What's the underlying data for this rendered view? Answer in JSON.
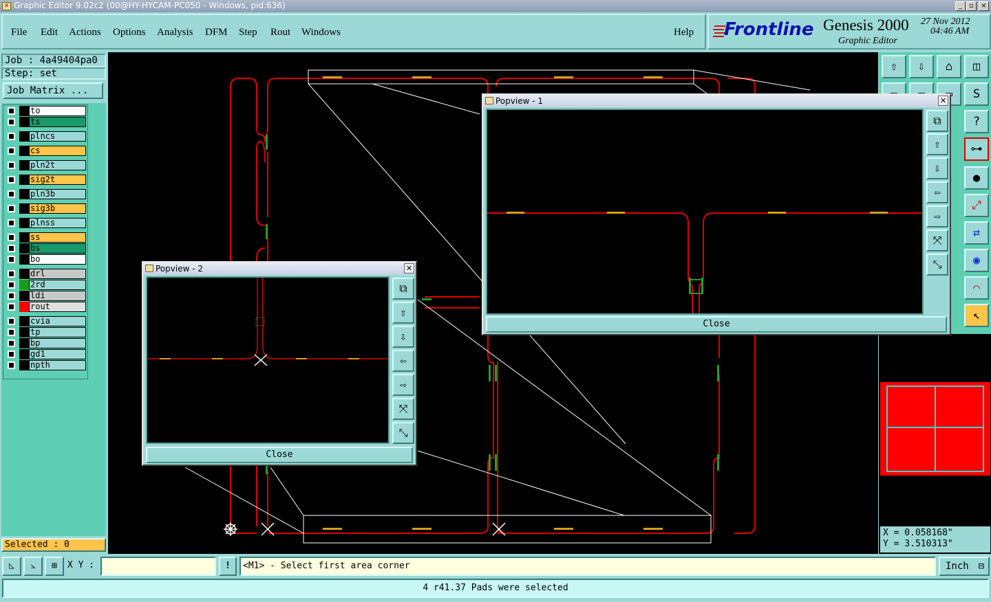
{
  "window": {
    "title": "Graphic Editor 9.02c2 (00@HY-HYCAM-PC050 - Windows, pid:636)",
    "minimize": "_",
    "maximize": "▫",
    "close": "×"
  },
  "menu": [
    "File",
    "Edit",
    "Actions",
    "Options",
    "Analysis",
    "DFM",
    "Step",
    "Rout",
    "Windows"
  ],
  "help": "Help",
  "brand": {
    "logo": "Frontline",
    "product": "Genesis 2000",
    "subtitle": "Graphic Editor",
    "date": "27 Nov 2012",
    "time": "04:46 AM"
  },
  "job": {
    "label": "Job : 4a49404pa0",
    "step": "Step: set",
    "matrix_button": "Job Matrix ..."
  },
  "layers": [
    {
      "name": "to",
      "bg": "#ffffff",
      "sw": "#000000"
    },
    {
      "name": "ts",
      "bg": "#1a9a6a",
      "sw": "#000000"
    },
    {
      "name": "plncs",
      "bg": "#9cd9d6",
      "sw": "#000000"
    },
    {
      "name": "cs",
      "bg": "#ffc44a",
      "sw": "#000000"
    },
    {
      "name": "pln2t",
      "bg": "#9cd9d6",
      "sw": "#000000"
    },
    {
      "name": "sig2t",
      "bg": "#ffc44a",
      "sw": "#000000"
    },
    {
      "name": "pln3b",
      "bg": "#9cd9d6",
      "sw": "#000000"
    },
    {
      "name": "sig3b",
      "bg": "#ffc44a",
      "sw": "#000000"
    },
    {
      "name": "plnss",
      "bg": "#9cd9d6",
      "sw": "#000000"
    },
    {
      "name": "ss",
      "bg": "#ffc44a",
      "sw": "#000000"
    },
    {
      "name": "bs",
      "bg": "#1a9a6a",
      "sw": "#000000"
    },
    {
      "name": "bo",
      "bg": "#ffffff",
      "sw": "#000000"
    },
    {
      "name": "drl",
      "bg": "#c8c8c8",
      "sw": "#000000"
    },
    {
      "name": "2rd",
      "bg": "#9cd9d6",
      "sw": "#1a9a1a"
    },
    {
      "name": "ldi",
      "bg": "#c8c8c8",
      "sw": "#000000"
    },
    {
      "name": "rout",
      "bg": "#e0e0e0",
      "sw": "#ff0000"
    },
    {
      "name": "cvia",
      "bg": "#9cd9d6",
      "sw": "#000000"
    },
    {
      "name": "tp",
      "bg": "#9cd9d6",
      "sw": "#000000"
    },
    {
      "name": "bp",
      "bg": "#9cd9d6",
      "sw": "#000000"
    },
    {
      "name": "gd1",
      "bg": "#9cd9d6",
      "sw": "#000000"
    },
    {
      "name": "npth",
      "bg": "#9cd9d6",
      "sw": "#000000"
    }
  ],
  "selected": "Selected : 0",
  "popview1": {
    "title": "Popview - 1",
    "close": "Close"
  },
  "popview2": {
    "title": "Popview - 2",
    "close": "Close"
  },
  "coords": {
    "x": "X = 0.058168\"",
    "y": "Y = 3.510313\""
  },
  "bottom": {
    "xy_label": "X Y :",
    "xy_value": "",
    "prompt": "<M1> - Select first area corner",
    "units": "Inch",
    "status": "4 r41.37 Pads were selected",
    "info_button": "!"
  },
  "colors": {
    "trace": "#e00000",
    "pad": "#d4a017",
    "green_pad": "#2a9a2a",
    "panel": "#9cd9d6"
  }
}
